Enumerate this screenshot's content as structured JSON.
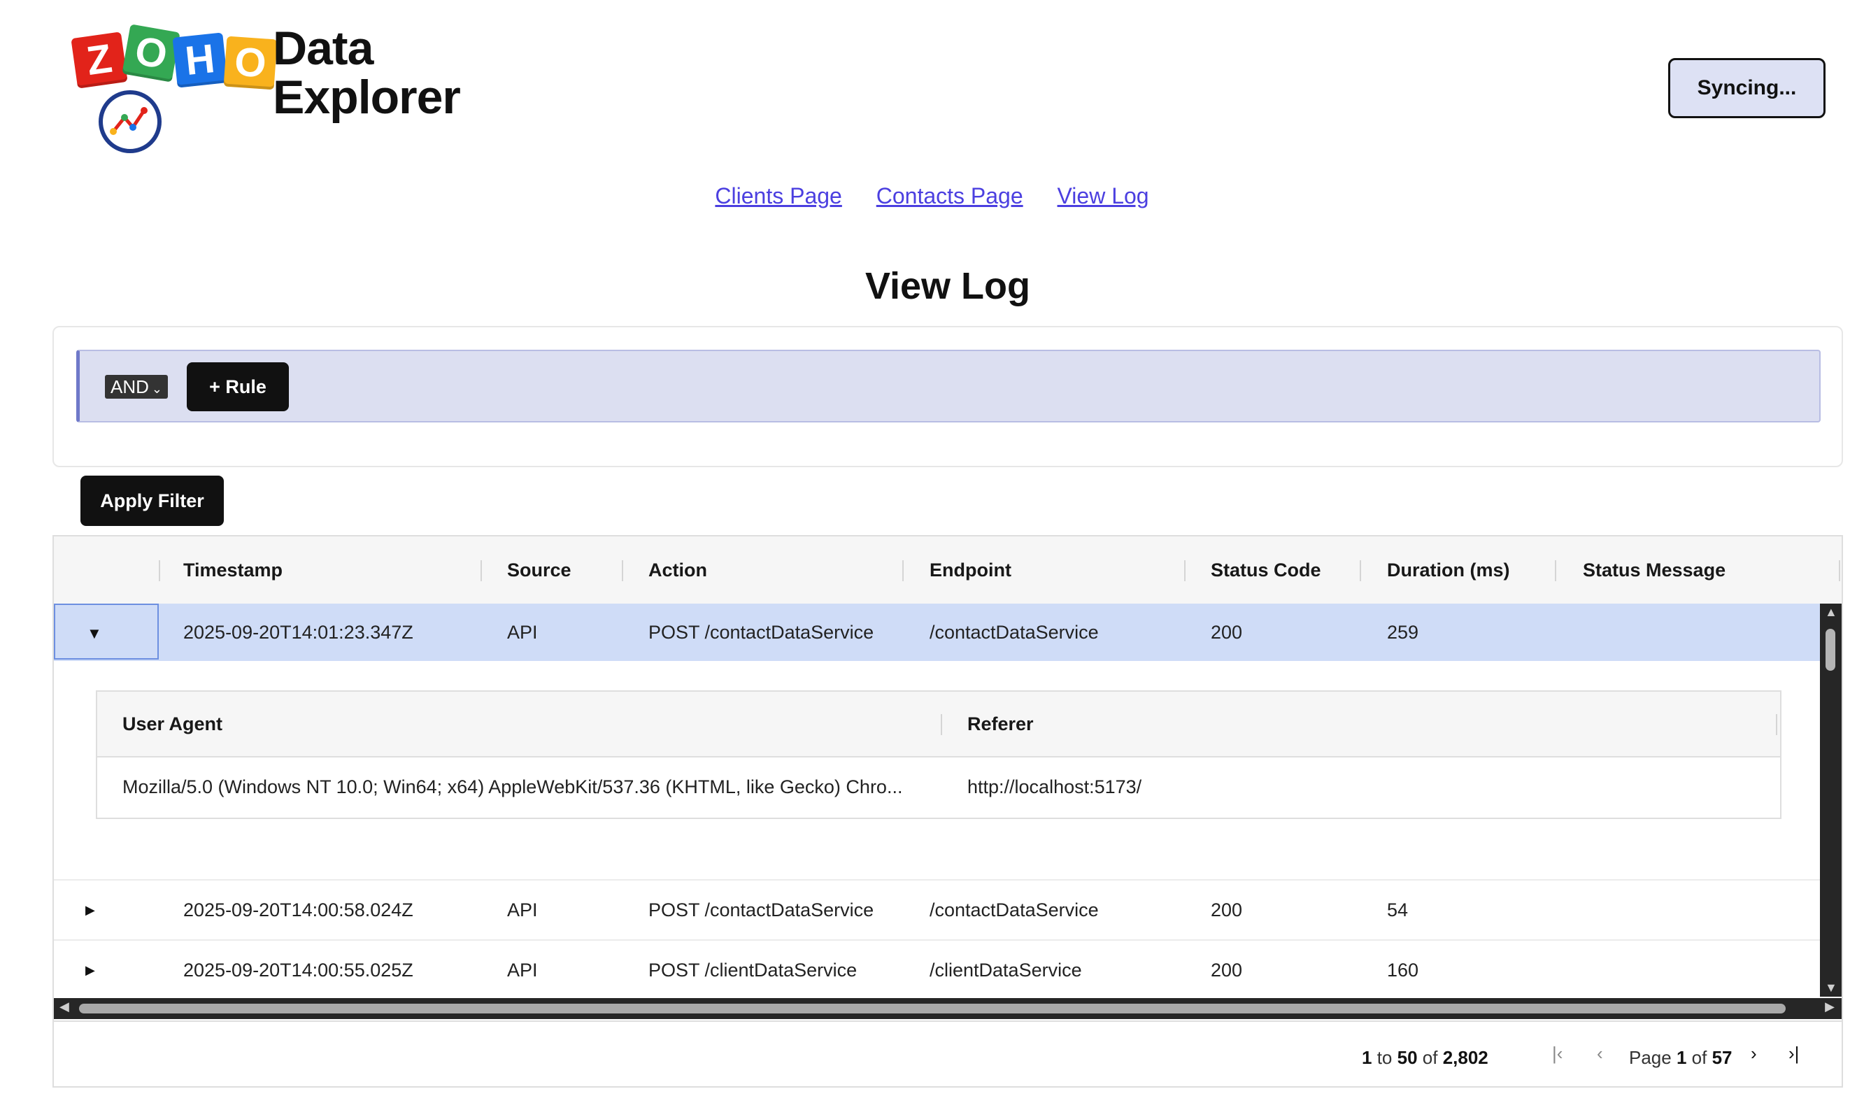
{
  "app": {
    "logo_letters": [
      "Z",
      "O",
      "H",
      "O"
    ],
    "logo_title_line1": "Data",
    "logo_title_line2": "Explorer",
    "sync_button": "Syncing..."
  },
  "nav": {
    "links": [
      "Clients Page",
      "Contacts Page",
      "View Log"
    ]
  },
  "page": {
    "title": "View Log"
  },
  "filter": {
    "combinator": "AND",
    "add_rule": "+ Rule",
    "apply": "Apply Filter"
  },
  "grid": {
    "columns": [
      "Timestamp",
      "Source",
      "Action",
      "Endpoint",
      "Status Code",
      "Duration (ms)",
      "Status Message"
    ],
    "rows": [
      {
        "timestamp": "2025-09-20T14:01:23.347Z",
        "source": "API",
        "action": "POST /contactDataService",
        "endpoint": "/contactDataService",
        "status_code": "200",
        "duration": "259",
        "status_message": ""
      },
      {
        "timestamp": "2025-09-20T14:00:58.024Z",
        "source": "API",
        "action": "POST /contactDataService",
        "endpoint": "/contactDataService",
        "status_code": "200",
        "duration": "54",
        "status_message": ""
      },
      {
        "timestamp": "2025-09-20T14:00:55.025Z",
        "source": "API",
        "action": "POST /clientDataService",
        "endpoint": "/clientDataService",
        "status_code": "200",
        "duration": "160",
        "status_message": ""
      }
    ],
    "detail": {
      "columns": [
        "User Agent",
        "Referer"
      ],
      "user_agent": "Mozilla/5.0 (Windows NT 10.0; Win64; x64) AppleWebKit/537.36 (KHTML, like Gecko) Chro...",
      "referer": "http://localhost:5173/"
    }
  },
  "pager": {
    "from": "1",
    "to_word": "to",
    "to": "50",
    "of_word": "of",
    "total": "2,802",
    "page_word": "Page",
    "page": "1",
    "page_of_word": "of",
    "pages": "57"
  },
  "colors": {
    "accent_link": "#4b3fe0",
    "selected_row": "#cfdcf7",
    "rule_group": "#dcdff1"
  }
}
